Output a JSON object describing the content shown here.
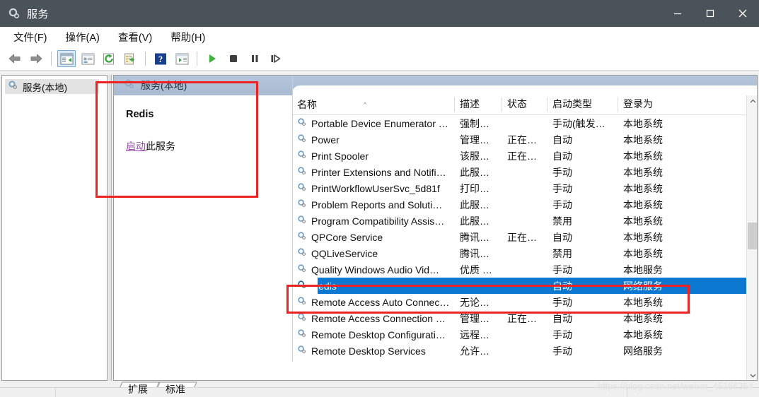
{
  "window": {
    "title": "服务",
    "title_icon": "gear-icon",
    "minimize_label": "—",
    "maximize_label": "□",
    "close_label": "✕"
  },
  "menubar": {
    "items": [
      {
        "label": "文件(F)",
        "name": "menu-file"
      },
      {
        "label": "操作(A)",
        "name": "menu-action"
      },
      {
        "label": "查看(V)",
        "name": "menu-view"
      },
      {
        "label": "帮助(H)",
        "name": "menu-help"
      }
    ]
  },
  "toolbar": {
    "items": [
      {
        "name": "back-icon",
        "tip": "后退"
      },
      {
        "name": "forward-icon",
        "tip": "前进"
      },
      {
        "name": "show-hide-console-tree-icon",
        "tip": "显示/隐藏控制台树",
        "selected": true
      },
      {
        "name": "properties-icon",
        "tip": "属性"
      },
      {
        "name": "refresh-icon",
        "tip": "刷新"
      },
      {
        "name": "export-list-icon",
        "tip": "导出列表"
      },
      {
        "name": "help-icon",
        "tip": "帮助"
      },
      {
        "name": "show-action-pane-icon",
        "tip": "显示/隐藏操作窗格"
      },
      {
        "name": "start-service-icon",
        "tip": "启动服务"
      },
      {
        "name": "stop-service-icon",
        "tip": "停止服务"
      },
      {
        "name": "pause-service-icon",
        "tip": "暂停服务"
      },
      {
        "name": "restart-service-icon",
        "tip": "重新启动服务"
      }
    ]
  },
  "tree": {
    "root_label": "服务(本地)",
    "root_icon": "gear-icon"
  },
  "pane": {
    "header_label": "服务(本地)",
    "header_icon": "gear-icon"
  },
  "detail": {
    "service_name": "Redis",
    "action_link": "启动",
    "action_suffix": "此服务"
  },
  "list": {
    "columns": [
      {
        "label": "名称",
        "name": "column-name"
      },
      {
        "label": "描述",
        "name": "column-description"
      },
      {
        "label": "状态",
        "name": "column-status"
      },
      {
        "label": "启动类型",
        "name": "column-startup-type"
      },
      {
        "label": "登录为",
        "name": "column-log-on-as"
      }
    ],
    "sort_indicator": "^",
    "rows": [
      {
        "name": "Portable Device Enumerator …",
        "desc": "强制…",
        "state": "",
        "startup": "手动(触发…",
        "logon": "本地系统",
        "selected": false
      },
      {
        "name": "Power",
        "desc": "管理…",
        "state": "正在…",
        "startup": "自动",
        "logon": "本地系统",
        "selected": false
      },
      {
        "name": "Print Spooler",
        "desc": "该服…",
        "state": "正在…",
        "startup": "自动",
        "logon": "本地系统",
        "selected": false
      },
      {
        "name": "Printer Extensions and Notifi…",
        "desc": "此服…",
        "state": "",
        "startup": "手动",
        "logon": "本地系统",
        "selected": false
      },
      {
        "name": "PrintWorkflowUserSvc_5d81f",
        "desc": "打印…",
        "state": "",
        "startup": "手动",
        "logon": "本地系统",
        "selected": false
      },
      {
        "name": "Problem Reports and Soluti…",
        "desc": "此服…",
        "state": "",
        "startup": "手动",
        "logon": "本地系统",
        "selected": false
      },
      {
        "name": "Program Compatibility Assis…",
        "desc": "此服…",
        "state": "",
        "startup": "禁用",
        "logon": "本地系统",
        "selected": false
      },
      {
        "name": "QPCore Service",
        "desc": "腾讯…",
        "state": "正在…",
        "startup": "自动",
        "logon": "本地系统",
        "selected": false
      },
      {
        "name": "QQLiveService",
        "desc": "腾讯…",
        "state": "",
        "startup": "禁用",
        "logon": "本地系统",
        "selected": false
      },
      {
        "name": "Quality Windows Audio Vid…",
        "desc": "优质 …",
        "state": "",
        "startup": "手动",
        "logon": "本地服务",
        "selected": false
      },
      {
        "name": "Redis",
        "desc": "",
        "state": "",
        "startup": "自动",
        "logon": "网络服务",
        "selected": true
      },
      {
        "name": "Remote Access Auto Connec…",
        "desc": "无论…",
        "state": "",
        "startup": "手动",
        "logon": "本地系统",
        "selected": false
      },
      {
        "name": "Remote Access Connection …",
        "desc": "管理…",
        "state": "正在…",
        "startup": "自动",
        "logon": "本地系统",
        "selected": false
      },
      {
        "name": "Remote Desktop Configurati…",
        "desc": "远程…",
        "state": "",
        "startup": "手动",
        "logon": "本地系统",
        "selected": false
      },
      {
        "name": "Remote Desktop Services",
        "desc": "允许…",
        "state": "",
        "startup": "手动",
        "logon": "网络服务",
        "selected": false
      }
    ]
  },
  "tabs": [
    {
      "label": "扩展",
      "name": "tab-extended",
      "active": false
    },
    {
      "label": "标准",
      "name": "tab-standard",
      "active": true
    }
  ],
  "watermark": "https://blog.csdn.net/weixin_45166354",
  "colors": {
    "titlebar": "#4a525a",
    "selection": "#0d78d1",
    "annotation": "#ee2222",
    "link": "#9b4ba8",
    "pane_header": "#a8bbd2"
  }
}
